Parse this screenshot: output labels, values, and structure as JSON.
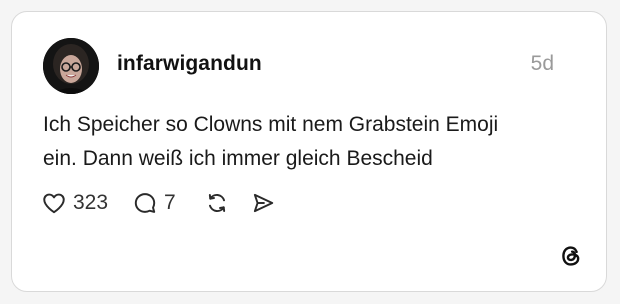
{
  "post": {
    "username": "infarwigandun",
    "time": "5d",
    "text_line1": "Ich Speicher so Clowns mit nem Grabstein Emoji",
    "text_line2": "ein. Dann weiß ich immer gleich Bescheid"
  },
  "actions": {
    "likes": "323",
    "replies": "7",
    "like_icon": "heart-icon",
    "reply_icon": "speech-bubble-icon",
    "repost_icon": "repost-arrows-icon",
    "share_icon": "paper-plane-icon"
  },
  "brand": {
    "logo": "threads-logo-icon"
  },
  "colors": {
    "card_background": "#ffffff",
    "card_border": "#d9d9d9",
    "text_primary": "#111111",
    "text_muted": "#9a9a9a"
  }
}
